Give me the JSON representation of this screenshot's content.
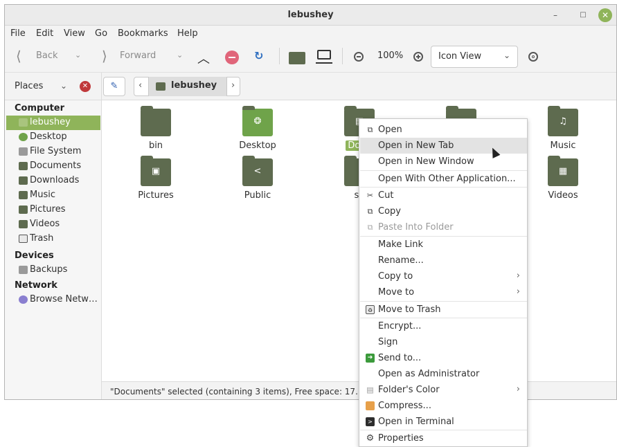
{
  "window": {
    "title": "lebushey"
  },
  "menubar": [
    "File",
    "Edit",
    "View",
    "Go",
    "Bookmarks",
    "Help"
  ],
  "toolbar": {
    "back": "Back",
    "forward": "Forward",
    "zoom": "100%",
    "view_mode": "Icon View"
  },
  "places": {
    "label": "Places"
  },
  "path": {
    "current": "lebushey"
  },
  "sidebar": {
    "computer": "Computer",
    "computer_items": [
      "lebushey",
      "Desktop",
      "File System",
      "Documents",
      "Downloads",
      "Music",
      "Pictures",
      "Videos",
      "Trash"
    ],
    "devices": "Devices",
    "device_items": [
      "Backups"
    ],
    "network": "Network",
    "network_items": [
      "Browse Netw…"
    ]
  },
  "files": [
    "bin",
    "Desktop",
    "Documents",
    "",
    "Music",
    "Pictures",
    "Public",
    "snap",
    "",
    "Videos"
  ],
  "files_visible": {
    "documents": "Docu",
    "snap": "sn"
  },
  "status": "\"Documents\" selected (containing 3 items), Free space: 17.",
  "context_menu": [
    "Open",
    "Open in New Tab",
    "Open in New Window",
    "Open With Other Application...",
    "Cut",
    "Copy",
    "Paste Into Folder",
    "Make Link",
    "Rename...",
    "Copy to",
    "Move to",
    "Move to Trash",
    "Encrypt...",
    "Sign",
    "Send to...",
    "Open as Administrator",
    "Folder's Color",
    "Compress...",
    "Open in Terminal",
    "Properties"
  ],
  "colors": {
    "accent": "#8fb45a",
    "folder": "#5e6b4f",
    "danger": "#c0393b"
  }
}
